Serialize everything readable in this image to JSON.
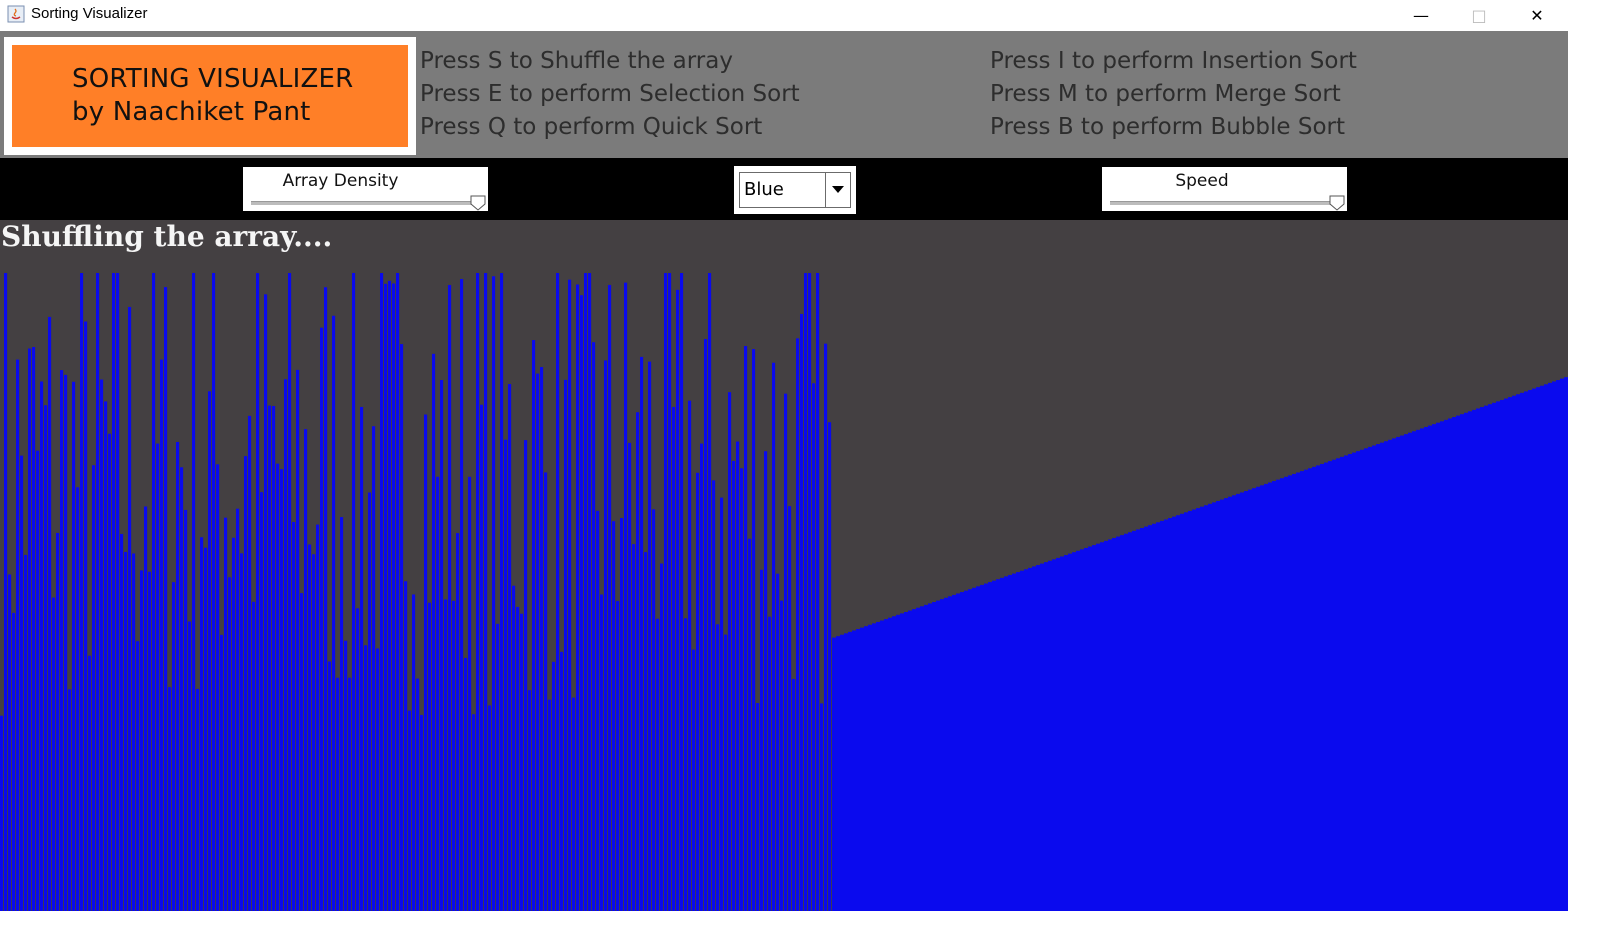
{
  "window": {
    "title": "Sorting Visualizer",
    "min_icon": "minimize-icon",
    "max_icon": "maximize-icon",
    "close_icon": "close-icon"
  },
  "header": {
    "logo_line1": "SORTING VISUALIZER",
    "logo_line2": "by Naachiket Pant",
    "instructions_left": [
      "Press S to Shuffle the array",
      "Press E to perform Selection Sort",
      "Press Q to perform Quick Sort"
    ],
    "instructions_right": [
      "Press I to perform Insertion Sort",
      "Press M to perform Merge Sort",
      "Press B to perform Bubble Sort"
    ]
  },
  "controls": {
    "density_label": "Array Density",
    "density_value": 1.0,
    "color_selected": "Blue",
    "speed_label": "Speed",
    "speed_value": 1.0
  },
  "status": "Shuffling the array....",
  "colors": {
    "bar": "#0a0aee",
    "viz_bg": "#444042",
    "header_bg": "#7b7b7b",
    "logo_bg": "#ff7f27"
  },
  "chart_data": {
    "type": "bar",
    "description_values": "array bar heights; left portion shuffled, right portion ascending",
    "shuffled_fraction": 0.53,
    "sorted_start": 0.42,
    "sorted_end": 0.82
  }
}
